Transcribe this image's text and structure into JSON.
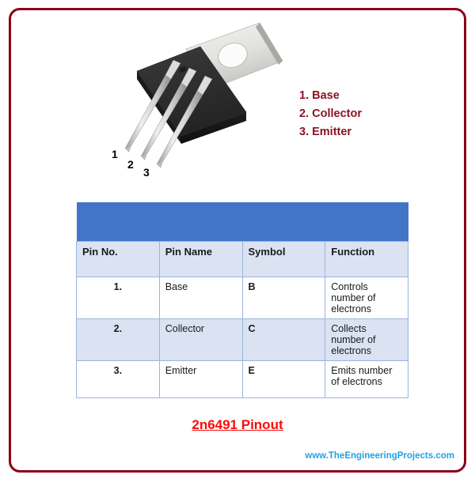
{
  "frame": {
    "border_color": "#8b0017"
  },
  "figure": {
    "alt_name": "to-220-transistor-photo",
    "pin_markers": [
      "1",
      "2",
      "3"
    ]
  },
  "pin_legend": {
    "items": [
      "1. Base",
      "2. Collector",
      "3. Emitter"
    ],
    "color": "#8b1323"
  },
  "table": {
    "banner_color": "#4274c8",
    "header_bg": "#dbe3f3",
    "border_color": "#9cb3de",
    "banner_text": "",
    "headers": [
      "Pin No.",
      "Pin Name",
      "Symbol",
      "Function"
    ],
    "rows": [
      {
        "no": "1.",
        "name": "Base",
        "symbol": "B",
        "function": "Controls number of electrons"
      },
      {
        "no": "2.",
        "name": "Collector",
        "symbol": "C",
        "function": "Collects number of electrons"
      },
      {
        "no": "3.",
        "name": "Emitter",
        "symbol": "E",
        "function": "Emits number of electrons"
      }
    ]
  },
  "caption": {
    "text": "2n6491 Pinout",
    "color": "#fb0a0a"
  },
  "footer": {
    "text": "www.TheEngineeringProjects.com",
    "color": "#21a2e0"
  }
}
